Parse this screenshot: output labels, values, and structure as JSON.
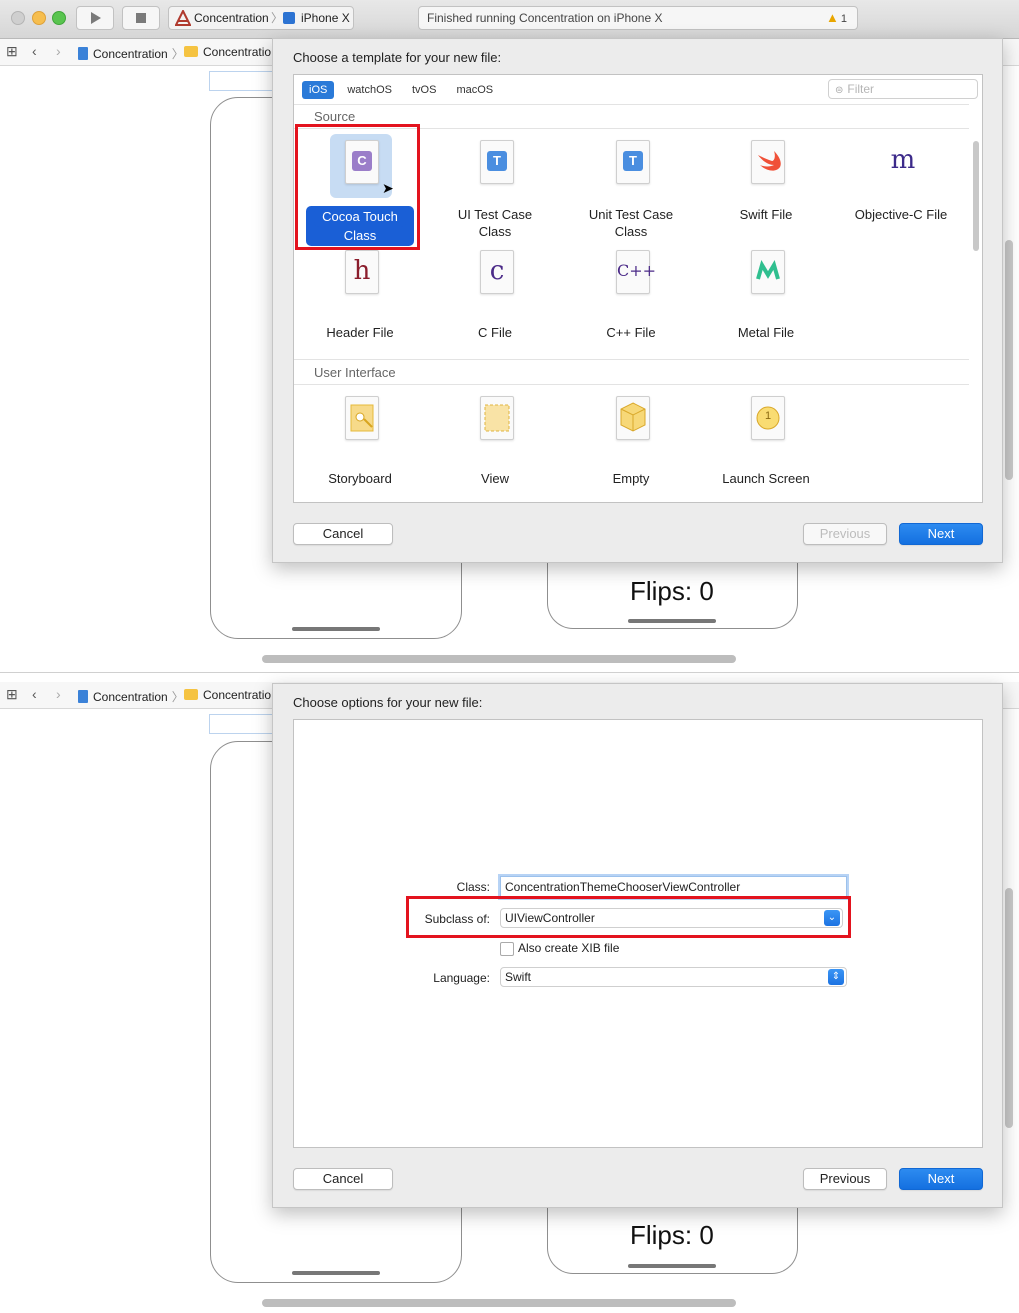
{
  "titlebar": {
    "scheme_app": "Concentration",
    "scheme_device": "iPhone X",
    "status": "Finished running Concentration on iPhone X",
    "warning_count": "1"
  },
  "jumpbar": {
    "project": "Concentration",
    "folder": "Concentratio"
  },
  "canvas": {
    "flips_label": "Flips: 0"
  },
  "template_dialog": {
    "title": "Choose a template for your new file:",
    "platform_tabs": [
      "iOS",
      "watchOS",
      "tvOS",
      "macOS"
    ],
    "active_tab": "iOS",
    "filter_placeholder": "Filter",
    "sections": [
      {
        "label": "Source",
        "items": [
          {
            "line1": "Cocoa Touch",
            "line2": "Class",
            "selected": true
          },
          {
            "line1": "UI Test Case",
            "line2": "Class"
          },
          {
            "line1": "Unit Test Case",
            "line2": "Class"
          },
          {
            "line1": "Swift File",
            "line2": ""
          },
          {
            "line1": "Objective-C File",
            "line2": ""
          },
          {
            "line1": "Header File",
            "line2": ""
          },
          {
            "line1": "C File",
            "line2": ""
          },
          {
            "line1": "C++ File",
            "line2": ""
          },
          {
            "line1": "Metal File",
            "line2": ""
          }
        ]
      },
      {
        "label": "User Interface",
        "items": [
          {
            "line1": "Storyboard",
            "line2": ""
          },
          {
            "line1": "View",
            "line2": ""
          },
          {
            "line1": "Empty",
            "line2": ""
          },
          {
            "line1": "Launch Screen",
            "line2": ""
          }
        ]
      }
    ],
    "icon_glyphs": {
      "cocoa": "C",
      "test": "T",
      "objc": "m",
      "header": "h",
      "c": "c",
      "cpp": "C++",
      "launch": "1"
    },
    "cancel": "Cancel",
    "previous": "Previous",
    "next": "Next"
  },
  "options_dialog": {
    "title": "Choose options for your new file:",
    "class_label": "Class:",
    "class_value": "ConcentrationThemeChooserViewController",
    "subclass_label": "Subclass of:",
    "subclass_value": "UIViewController",
    "xib_label": "Also create XIB file",
    "xib_checked": false,
    "language_label": "Language:",
    "language_value": "Swift",
    "cancel": "Cancel",
    "previous": "Previous",
    "next": "Next"
  },
  "colors": {
    "accent": "#1a6fe0",
    "highlight": "#e3131e",
    "selection": "#c7dcf3"
  }
}
